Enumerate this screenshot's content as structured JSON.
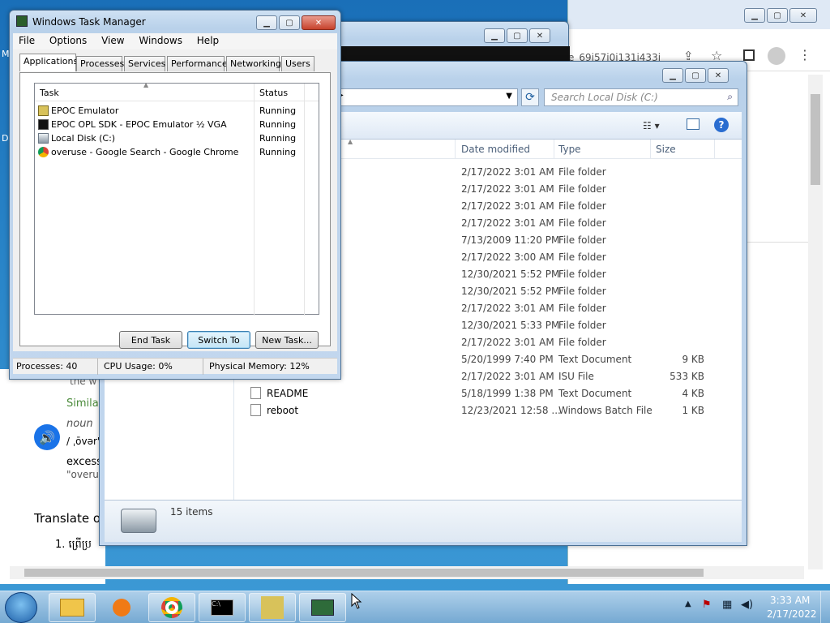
{
  "taskmgr": {
    "title": "Windows Task Manager",
    "menu": [
      "File",
      "Options",
      "View",
      "Windows",
      "Help"
    ],
    "tabs": [
      "Applications",
      "Processes",
      "Services",
      "Performance",
      "Networking",
      "Users"
    ],
    "columns": {
      "task": "Task",
      "status": "Status"
    },
    "apps": [
      {
        "icon": "epoc-icon",
        "name": "EPOC Emulator",
        "status": "Running"
      },
      {
        "icon": "epoc-sdk-icon",
        "name": "EPOC OPL SDK - EPOC Emulator ½ VGA",
        "status": "Running"
      },
      {
        "icon": "drive-icon",
        "name": "Local Disk (C:)",
        "status": "Running"
      },
      {
        "icon": "chrome-icon",
        "name": "overuse - Google Search - Google Chrome",
        "status": "Running"
      }
    ],
    "buttons": {
      "end": "End Task",
      "switch": "Switch To",
      "new": "New Task..."
    },
    "status": {
      "processes": "Processes: 40",
      "cpu": "CPU Usage: 0%",
      "memory": "Physical Memory: 12%"
    }
  },
  "explorer": {
    "search_placeholder": "Search Local Disk (C:)",
    "columns": {
      "date": "Date modified",
      "type": "Type",
      "size": "Size"
    },
    "rows": [
      {
        "name": "",
        "date": "2/17/2022 3:01 AM",
        "type": "File folder",
        "size": ""
      },
      {
        "name": "",
        "date": "2/17/2022 3:01 AM",
        "type": "File folder",
        "size": ""
      },
      {
        "name": "",
        "date": "2/17/2022 3:01 AM",
        "type": "File folder",
        "size": ""
      },
      {
        "name": "",
        "date": "2/17/2022 3:01 AM",
        "type": "File folder",
        "size": ""
      },
      {
        "name": "",
        "date": "7/13/2009 11:20 PM",
        "type": "File folder",
        "size": ""
      },
      {
        "name": "",
        "date": "2/17/2022 3:00 AM",
        "type": "File folder",
        "size": ""
      },
      {
        "name": "",
        "date": "12/30/2021 5:52 PM",
        "type": "File folder",
        "size": ""
      },
      {
        "name": "",
        "date": "12/30/2021 5:52 PM",
        "type": "File folder",
        "size": ""
      },
      {
        "name": "",
        "date": "2/17/2022 3:01 AM",
        "type": "File folder",
        "size": ""
      },
      {
        "name": "",
        "date": "12/30/2021 5:33 PM",
        "type": "File folder",
        "size": ""
      },
      {
        "name": "",
        "date": "2/17/2022 3:01 AM",
        "type": "File folder",
        "size": ""
      },
      {
        "name": "",
        "date": "5/20/1999 7:40 PM",
        "type": "Text Document",
        "size": "9 KB"
      },
      {
        "name": "",
        "date": "2/17/2022 3:01 AM",
        "type": "ISU File",
        "size": "533 KB"
      },
      {
        "name": "README",
        "date": "5/18/1999 1:38 PM",
        "type": "Text Document",
        "size": "4 KB"
      },
      {
        "name": "reboot",
        "date": "12/23/2021 12:58 ...",
        "type": "Windows Batch File",
        "size": "1 KB"
      }
    ],
    "item_count": "15 items"
  },
  "browser": {
    "url_fragment": "e_69i57j0i131i433i",
    "snippets": {
      "word": "the w",
      "similar": "Simila",
      "noun": "noun",
      "phon": "/ ˌōvər'",
      "excess": "excess",
      "quote": "\"overu",
      "translate": "Translate o",
      "item1": "1. ព្រើប្រ"
    }
  },
  "taskbar": {
    "time": "3:33 AM",
    "date": "2/17/2022"
  }
}
